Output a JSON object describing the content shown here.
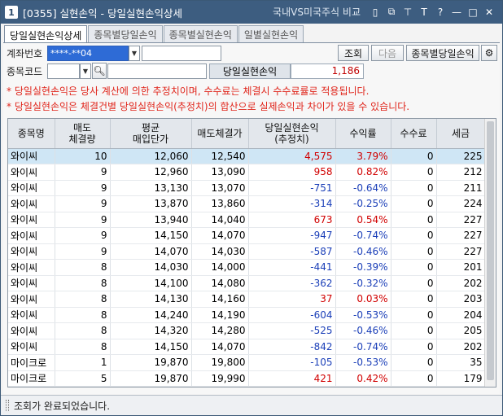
{
  "title": {
    "screen_no": "1",
    "text": "[0355]  실현손익  - 당일실현손익상세",
    "link": "국내VS미국주식 비교",
    "buttons": [
      "▯",
      "⧉",
      "⊤",
      "T",
      "?",
      "—",
      "□",
      "✕"
    ]
  },
  "tabs": [
    "당일실현손익상세",
    "종목별당일손익",
    "종목별실현손익",
    "일별실현손익"
  ],
  "form": {
    "account_label": "계좌번호",
    "account_value": "****-**04",
    "code_label": "종목코드",
    "query_button": "조회",
    "next_button": "다음",
    "by_stock_button": "종목별당일손익",
    "summary_label": "당일실현손익",
    "summary_value": "1,186"
  },
  "notices": [
    "* 당일실현손익은 당사 계산에 의한 추정치이며, 수수료는 체결시 수수료률로 적용됩니다.",
    "* 당일실현손익은 체결건별 당일실현손익(추정치)의 합산으로 실제손익과 차이가 있을 수 있습니다."
  ],
  "columns": [
    {
      "l1": "종목명",
      "l2": ""
    },
    {
      "l1": "매도",
      "l2": "체결량"
    },
    {
      "l1": "평균",
      "l2": "매입단가"
    },
    {
      "l1": "매도체결가",
      "l2": ""
    },
    {
      "l1": "당일실현손익",
      "l2": "(추정치)"
    },
    {
      "l1": "수익률",
      "l2": ""
    },
    {
      "l1": "수수료",
      "l2": ""
    },
    {
      "l1": "세금",
      "l2": ""
    }
  ],
  "rows": [
    [
      "와이씨",
      "10",
      "12,060",
      "12,540",
      "4,575",
      "3.79%",
      "0",
      "225"
    ],
    [
      "와이씨",
      "9",
      "12,960",
      "13,090",
      "958",
      "0.82%",
      "0",
      "212"
    ],
    [
      "와이씨",
      "9",
      "13,130",
      "13,070",
      "-751",
      "-0.64%",
      "0",
      "211"
    ],
    [
      "와이씨",
      "9",
      "13,870",
      "13,860",
      "-314",
      "-0.25%",
      "0",
      "224"
    ],
    [
      "와이씨",
      "9",
      "13,940",
      "14,040",
      "673",
      "0.54%",
      "0",
      "227"
    ],
    [
      "와이씨",
      "9",
      "14,150",
      "14,070",
      "-947",
      "-0.74%",
      "0",
      "227"
    ],
    [
      "와이씨",
      "9",
      "14,070",
      "14,030",
      "-587",
      "-0.46%",
      "0",
      "227"
    ],
    [
      "와이씨",
      "8",
      "14,030",
      "14,000",
      "-441",
      "-0.39%",
      "0",
      "201"
    ],
    [
      "와이씨",
      "8",
      "14,100",
      "14,080",
      "-362",
      "-0.32%",
      "0",
      "202"
    ],
    [
      "와이씨",
      "8",
      "14,130",
      "14,160",
      "37",
      "0.03%",
      "0",
      "203"
    ],
    [
      "와이씨",
      "8",
      "14,240",
      "14,190",
      "-604",
      "-0.53%",
      "0",
      "204"
    ],
    [
      "와이씨",
      "8",
      "14,320",
      "14,280",
      "-525",
      "-0.46%",
      "0",
      "205"
    ],
    [
      "와이씨",
      "8",
      "14,150",
      "14,070",
      "-842",
      "-0.74%",
      "0",
      "202"
    ],
    [
      "마이크로",
      "1",
      "19,870",
      "19,800",
      "-105",
      "-0.53%",
      "0",
      "35"
    ],
    [
      "마이크로",
      "5",
      "19,870",
      "19,990",
      "421",
      "0.42%",
      "0",
      "179"
    ]
  ],
  "status": "조회가 완료되었습니다.",
  "colors": {
    "profit": "#d10000",
    "loss": "#1b3fb8",
    "selected_row": "#cfe6f5",
    "titlebar": "#3d5d80"
  }
}
